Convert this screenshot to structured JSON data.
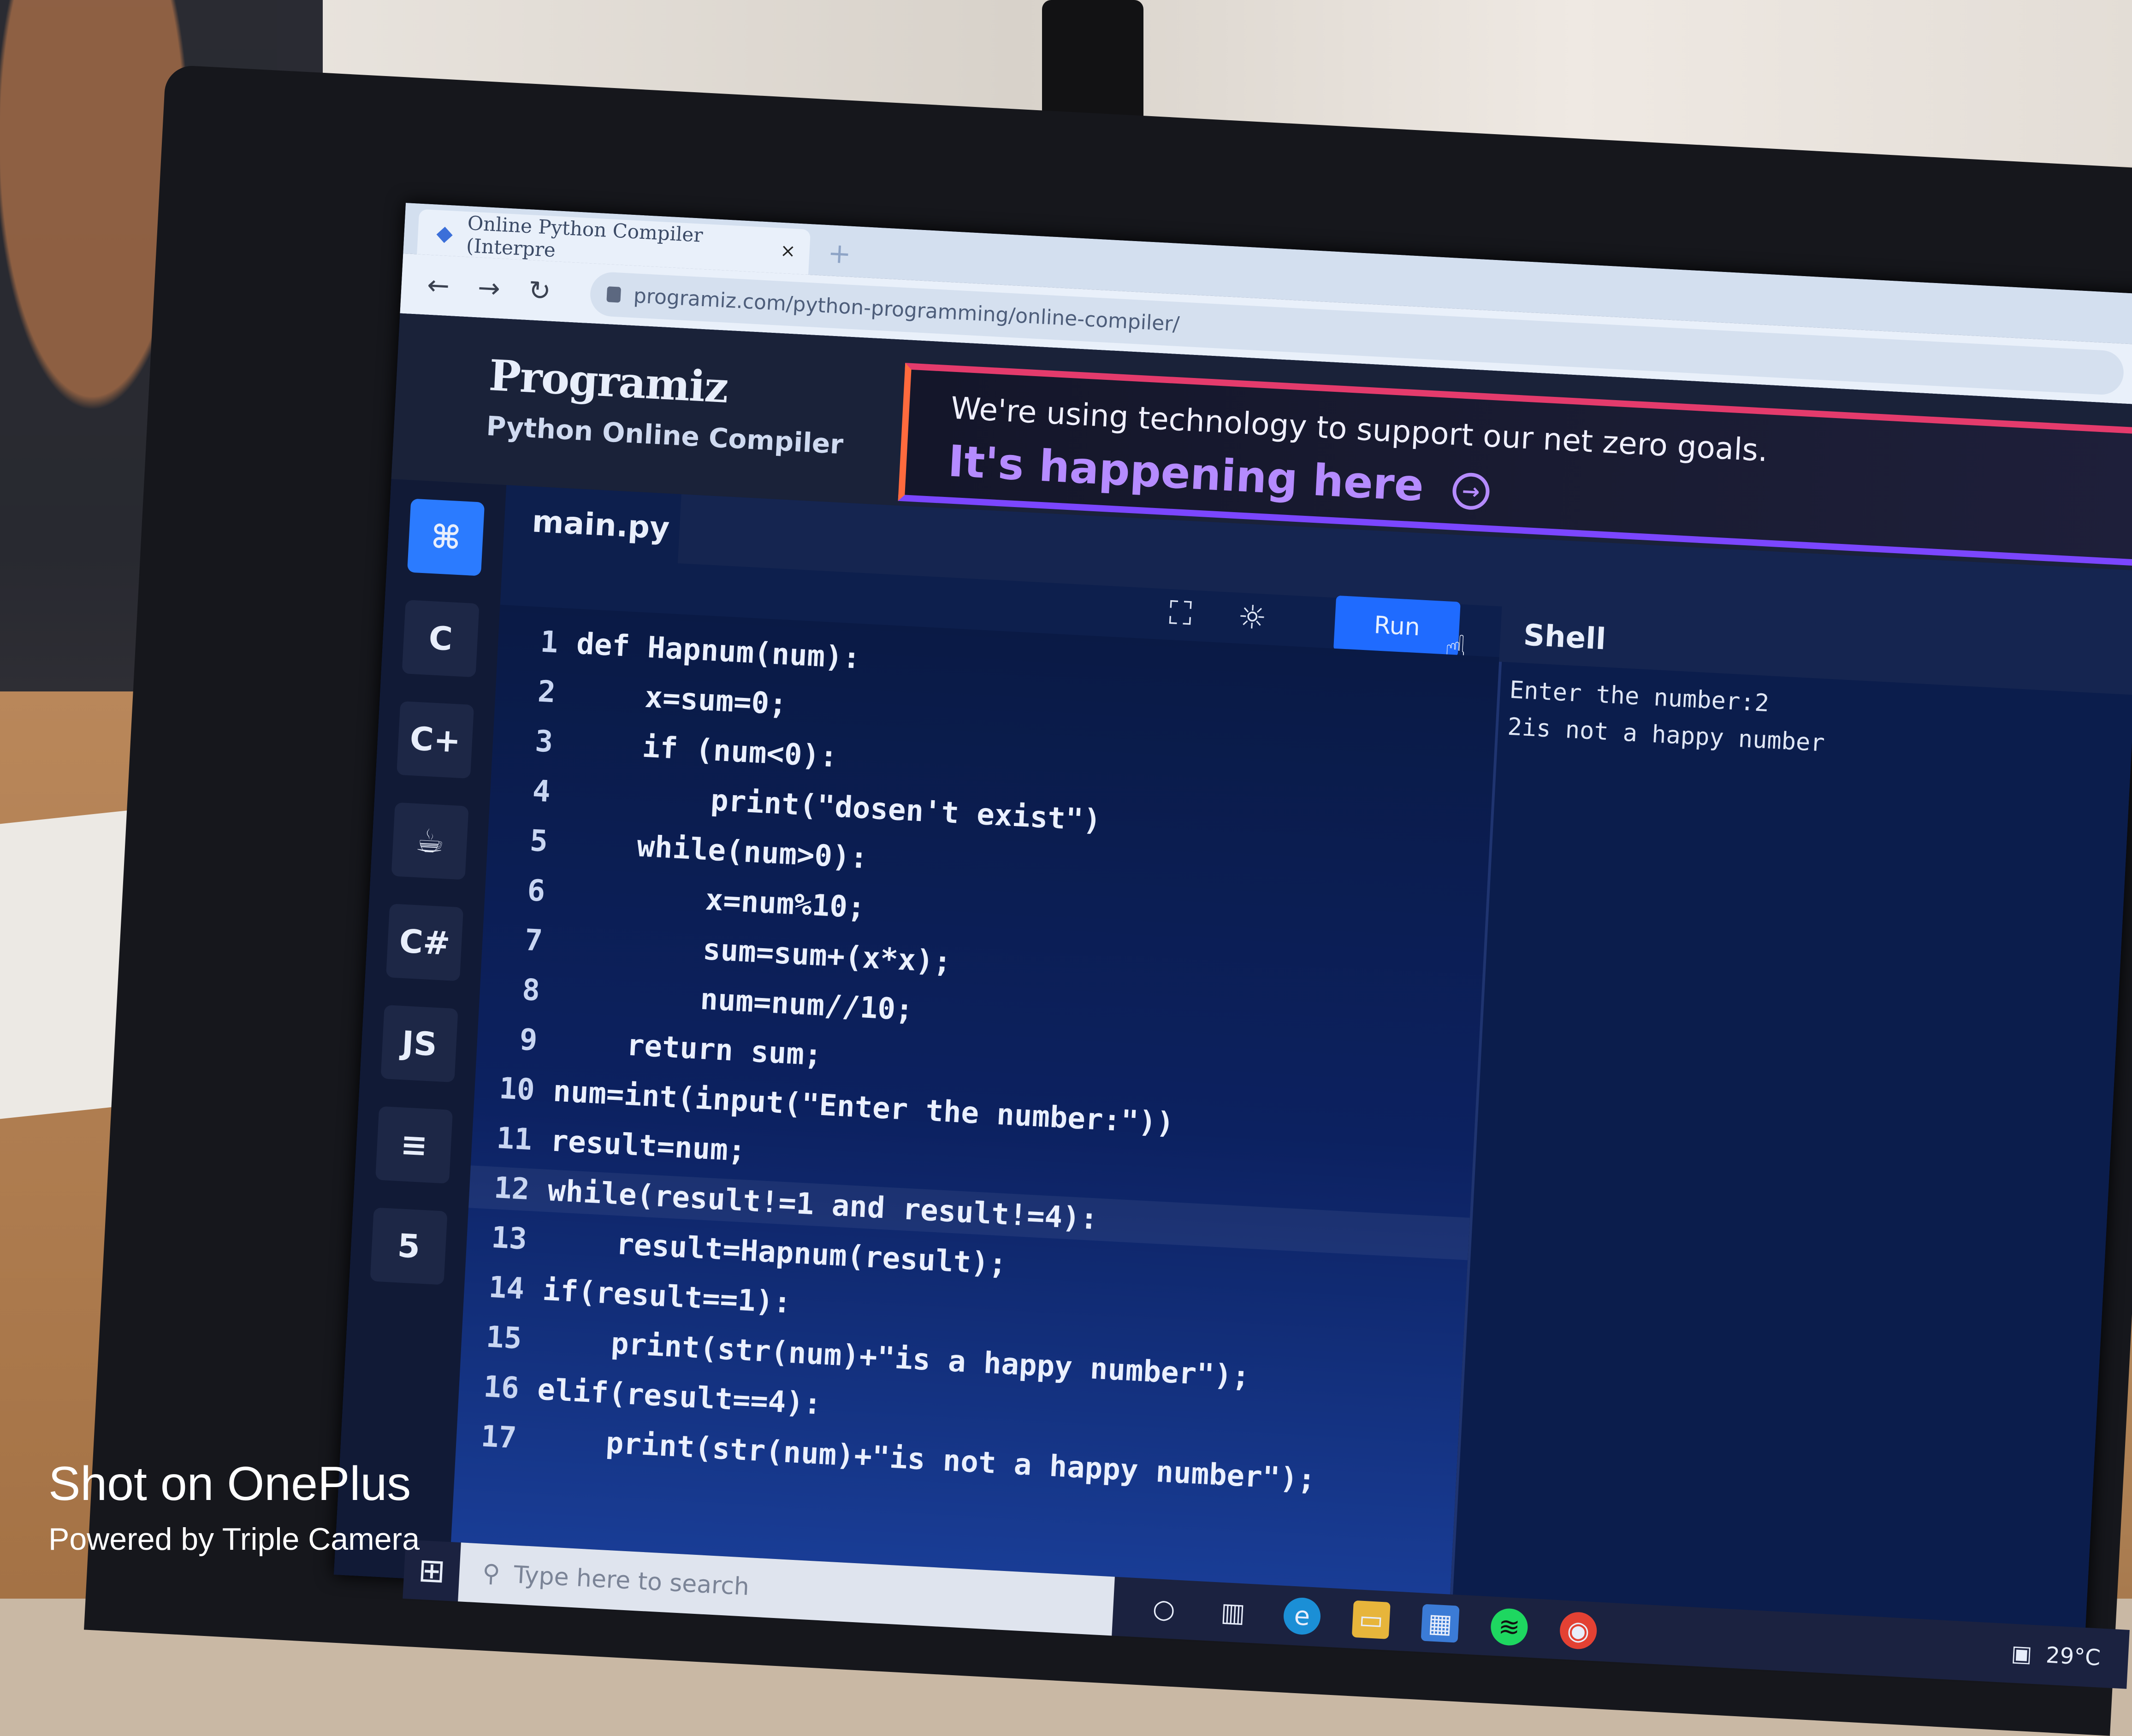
{
  "browser": {
    "tab_title": "Online Python Compiler (Interpre",
    "tab_close": "×",
    "new_tab": "+",
    "url": "programiz.com/python-programming/online-compiler/"
  },
  "site": {
    "logo": "Programiz",
    "subtitle": "Python Online Compiler"
  },
  "ad": {
    "line1": "We're using technology to support our net zero goals.",
    "line2": "It's happening here"
  },
  "rail": [
    {
      "icon": "python-icon",
      "label": ""
    },
    {
      "icon": "c-icon",
      "label": "C"
    },
    {
      "icon": "cpp-icon",
      "label": "C+"
    },
    {
      "icon": "java-icon",
      "label": "☕"
    },
    {
      "icon": "csharp-icon",
      "label": "C#"
    },
    {
      "icon": "javascript-icon",
      "label": "JS"
    },
    {
      "icon": "database-icon",
      "label": "≡"
    },
    {
      "icon": "html5-icon",
      "label": "5"
    }
  ],
  "editor": {
    "file_name": "main.py",
    "run_label": "Run",
    "lines": [
      {
        "n": "1",
        "code": "def Hapnum(num):"
      },
      {
        "n": "2",
        "code": "    x=sum=0;"
      },
      {
        "n": "3",
        "code": "    if (num<0):"
      },
      {
        "n": "4",
        "code": "        print(\"dosen't exist\")"
      },
      {
        "n": "5",
        "code": "    while(num>0):"
      },
      {
        "n": "6",
        "code": "        x=num%10;"
      },
      {
        "n": "7",
        "code": "        sum=sum+(x*x);"
      },
      {
        "n": "8",
        "code": "        num=num//10;"
      },
      {
        "n": "9",
        "code": "    return sum;"
      },
      {
        "n": "10",
        "code": "num=int(input(\"Enter the number:\"))"
      },
      {
        "n": "11",
        "code": "result=num;"
      },
      {
        "n": "12",
        "code": "while(result!=1 and result!=4):"
      },
      {
        "n": "13",
        "code": "    result=Hapnum(result);"
      },
      {
        "n": "14",
        "code": "if(result==1):"
      },
      {
        "n": "15",
        "code": "    print(str(num)+\"is a happy number\");"
      },
      {
        "n": "16",
        "code": "elif(result==4):"
      },
      {
        "n": "17",
        "code": "    print(str(num)+\"is not a happy number\");"
      }
    ]
  },
  "shell": {
    "title": "Shell",
    "output": [
      "Enter the number:2",
      "2is not a happy number"
    ]
  },
  "taskbar": {
    "search_placeholder": "Type here to search",
    "weather": "29°C"
  },
  "watermark": {
    "line1": "Shot on OnePlus",
    "line2": "Powered by Triple Camera"
  }
}
